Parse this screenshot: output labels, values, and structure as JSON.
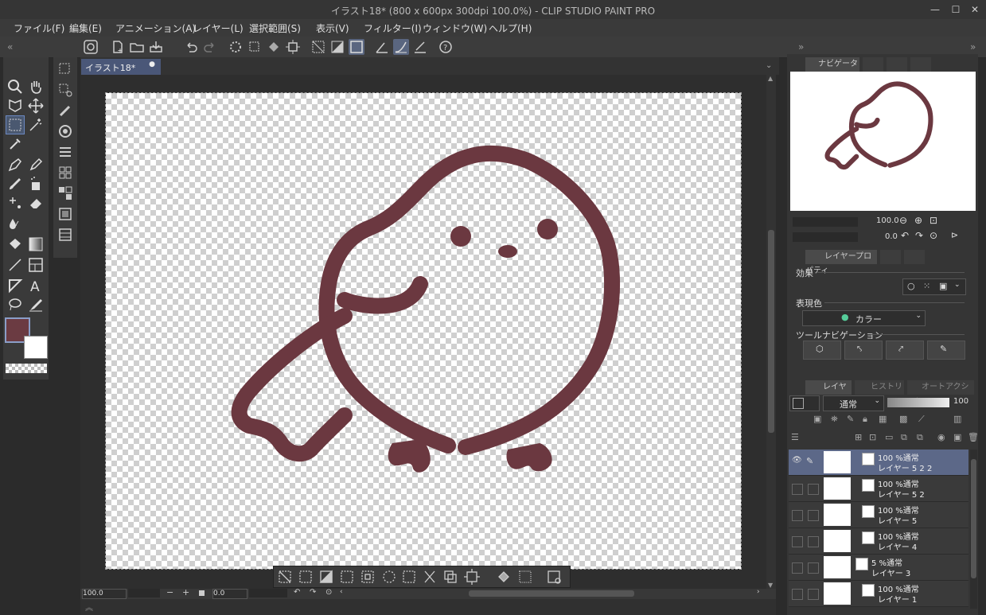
{
  "title": "イラスト18* (800 x 600px 300dpi 100.0%)  - CLIP STUDIO PAINT PRO",
  "menu": [
    "ファイル(F)",
    "編集(E)",
    "アニメーション(A)",
    "レイヤー(L)",
    "選択範囲(S)",
    "表示(V)",
    "フィルター(I)",
    "ウィンドウ(W)",
    "ヘルプ(H)"
  ],
  "doc_tab": "イラスト18*",
  "navigator": {
    "tab": "ナビゲーター",
    "zoom": "100.0",
    "rotate": "0.0"
  },
  "layer_property": {
    "tab": "レイヤープロパティ",
    "effect_label": "効果",
    "color_label": "表現色",
    "color_value": "カラー",
    "toolnav_label": "ツールナビゲーション"
  },
  "layer_panel": {
    "tabs": [
      "レイヤー",
      "ヒストリー",
      "オートアクション"
    ],
    "blend_mode": "通常",
    "opacity": "100",
    "layers": [
      {
        "line1": "100 %通常",
        "line2": "レイヤー 5 2 2",
        "selected": true
      },
      {
        "line1": "100 %通常",
        "line2": "レイヤー 5 2",
        "selected": false
      },
      {
        "line1": "100 %通常",
        "line2": "レイヤー 5",
        "selected": false
      },
      {
        "line1": "100 %通常",
        "line2": "レイヤー 4",
        "selected": false
      },
      {
        "line1": "5 %通常",
        "line2": "レイヤー 3",
        "selected": false
      },
      {
        "line1": "100 %通常",
        "line2": "レイヤー 1",
        "selected": false
      }
    ]
  },
  "status": {
    "zoom": "100.0",
    "angle": "0.0"
  },
  "colors": {
    "main_color": "#6b3b42",
    "sub_color": "#ffffff",
    "line_color": "#6b3840"
  }
}
